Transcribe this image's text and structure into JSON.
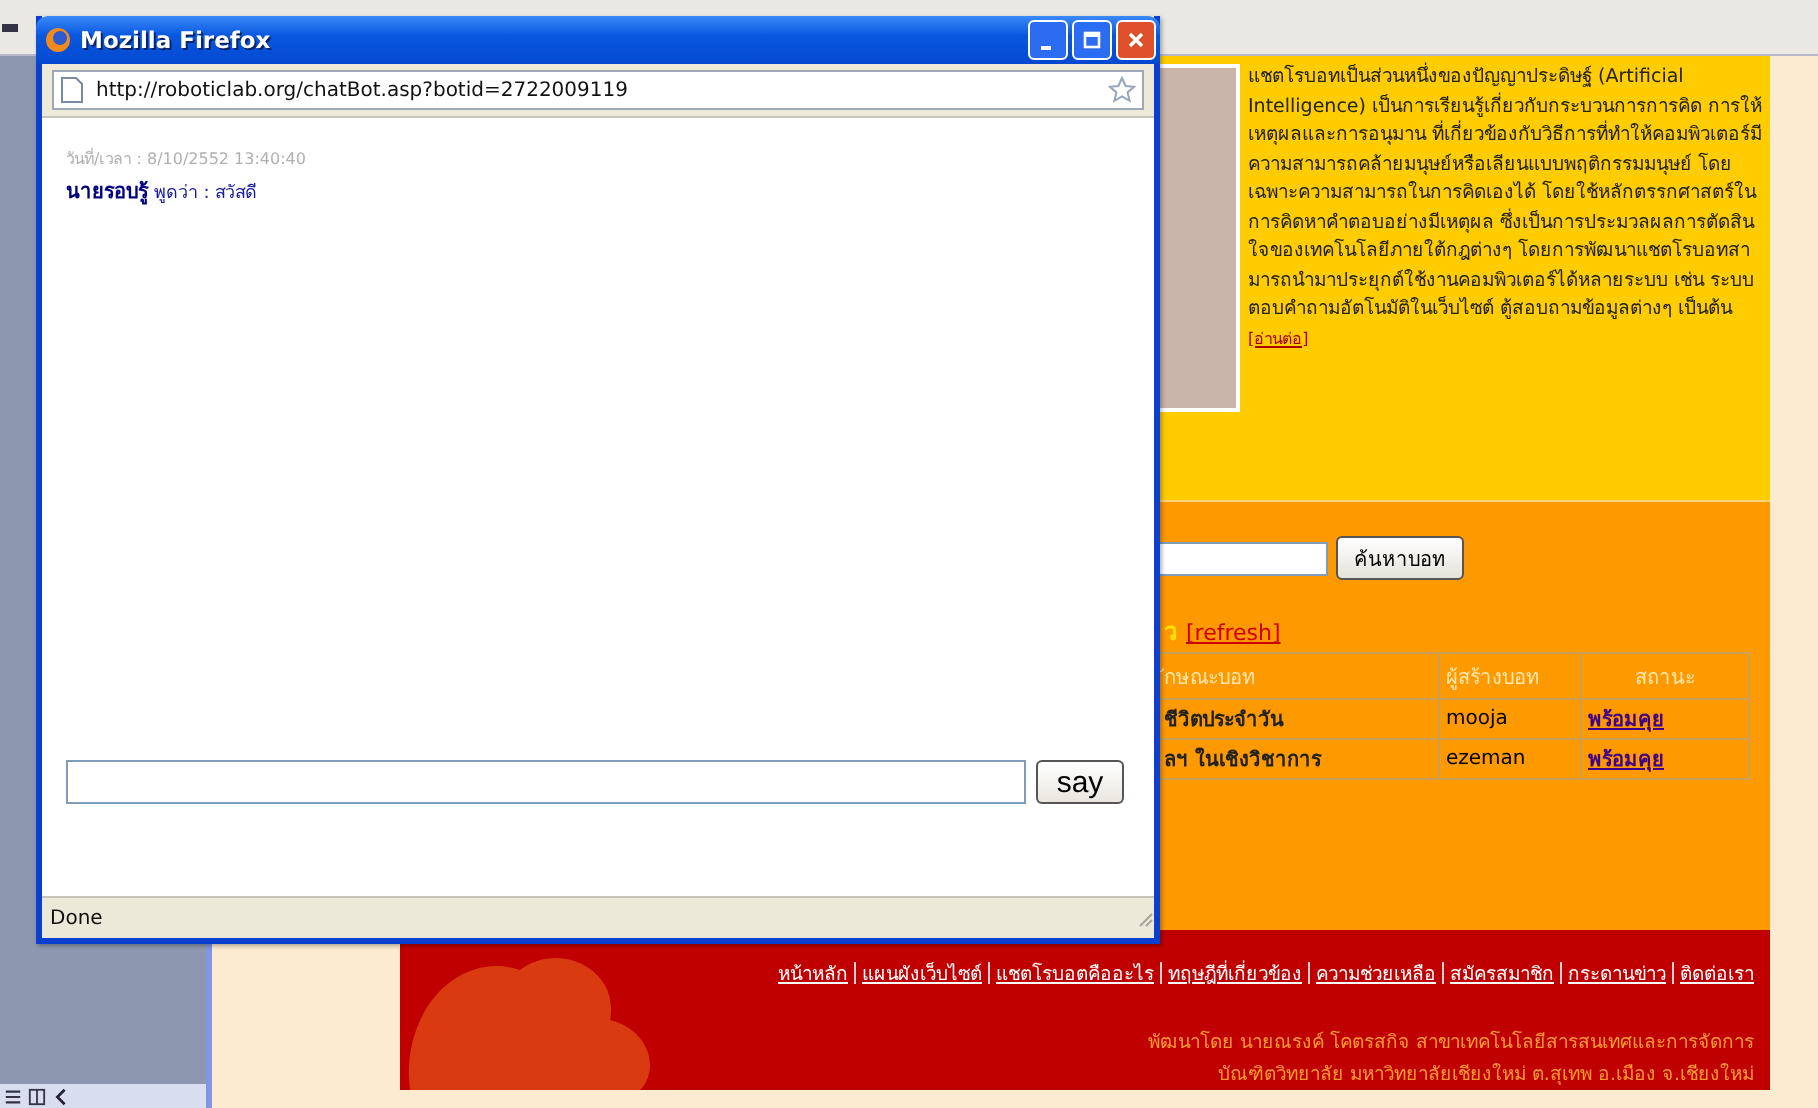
{
  "page": {
    "intro": {
      "text": "แชตโรบอทเป็นส่วนหนึ่งของปัญญาประดิษฐ์ (Artificial Intelligence) เป็นการเรียนรู้เกี่ยวกับกระบวนการการคิด การให้เหตุผลและการอนุมาน ที่เกี่ยวข้องกับวิธีการที่ทำให้คอมพิวเตอร์มีความสามารถคล้ายมนุษย์หรือเลียนแบบพฤติกรรมมนุษย์ โดยเฉพาะความสามารถในการคิดเองได้ โดยใช้หลักตรรกศาสตร์ในการคิดหาคำตอบอย่างมีเหตุผล ซึ่งเป็นการประมวลผลการตัดสินใจของเทคโนโลยีภายใต้กฎต่างๆ โดยการพัฒนาแชตโรบอทสามารถนำมาประยุกต์ใช้งานคอมพิวเตอร์ได้หลายระบบ เช่น ระบบตอบคำถามอัตโนมัติในเว็บไซต์ ตู้สอบถามข้อมูลต่างๆ เป็นต้น",
      "more_link": "[อ่านต่อ]"
    },
    "search": {
      "button": "ค้นหาบอท"
    },
    "bot_list": {
      "heading": "ว",
      "refresh_link": "[refresh]",
      "columns": [
        "ักษณะบอท",
        "ผู้สร้างบอท",
        "สถานะ"
      ],
      "rows": [
        {
          "cells": [
            "ชีวิตประจำวัน",
            "mooja",
            "พร้อมคุย"
          ]
        },
        {
          "cells": [
            "ลฯ ในเชิงวิชาการ",
            "ezeman",
            "พร้อมคุย"
          ]
        }
      ]
    },
    "footer": {
      "links": [
        "หน้าหลัก",
        "แผนผังเว็บไซต์",
        "แชตโรบอตคืออะไร",
        "ทฤษฎีที่เกี่ยวข้อง",
        "ความช่วยเหลือ",
        "สมัครสมาชิก",
        "กระดานข่าว",
        "ติดต่อเรา"
      ],
      "credit": [
        "พัฒนาโดย นายณรงค์  โคตรสกิจ สาขาเทคโนโลยีสารสนเทศและการจัดการ",
        "บัณฑิตวิทยาลัย มหาวิทยาลัยเชียงใหม่ ต.สุเทพ อ.เมือง จ.เชียงใหม่"
      ]
    }
  },
  "popup": {
    "title": "Mozilla Firefox",
    "url": "http://roboticlab.org/chatBot.asp?botid=2722009119",
    "chat": [
      {
        "timestamp": "วันที่/เวลา : 8/10/2552 13:40:40",
        "message": "**นายรอบรู้** พูดว่า : สวัสดี"
      }
    ],
    "say_button": "say",
    "status": "Done"
  }
}
